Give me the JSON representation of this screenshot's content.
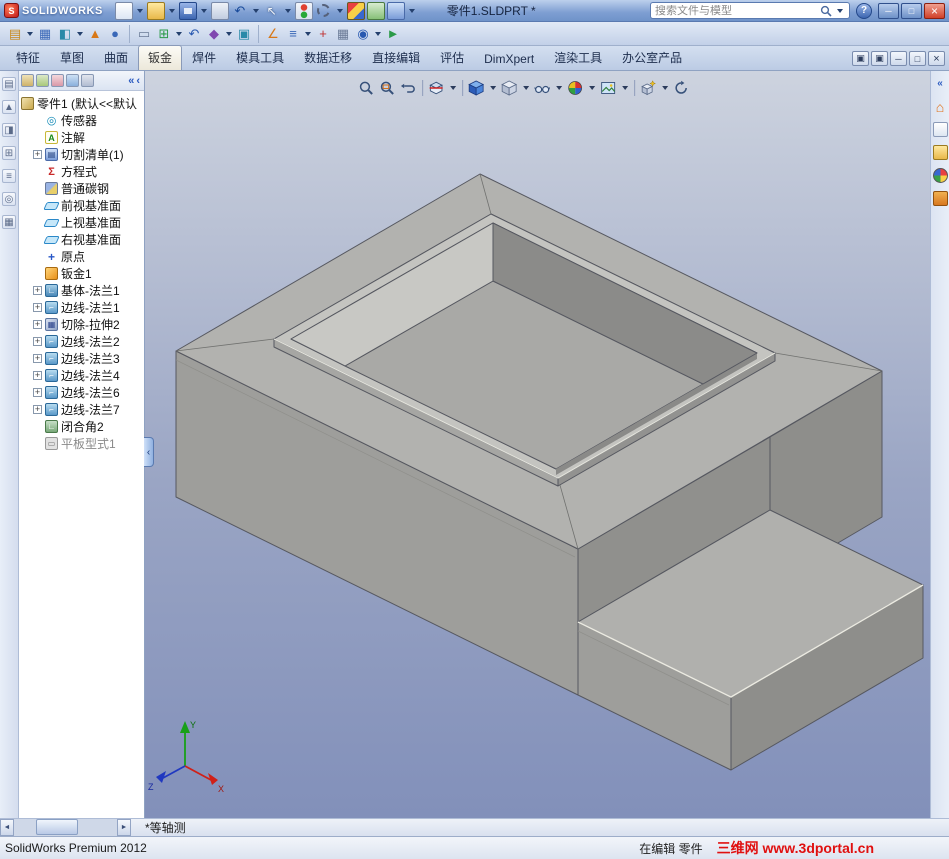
{
  "colors": {
    "titlebar_top": "#bdd0ec",
    "titlebar_bottom": "#6f93c9",
    "viewport_top": "#cdd3df",
    "viewport_bottom": "#8290ba",
    "accent_blue": "#2f66c0",
    "logo_red": "#c01818",
    "watermark_red": "#e01010",
    "part_top": "#b2b2af",
    "part_front": "#9e9e9b",
    "part_side": "#8e8e8b"
  },
  "title_bar": {
    "logo_text": "SOLIDWORKS",
    "doc_title": "零件1.SLDPRT *",
    "search_placeholder": "搜索文件与模型",
    "icons": [
      "new-document-icon",
      "open-icon",
      "save-icon",
      "print-icon",
      "undo-icon",
      "select-cursor-icon",
      "rebuild-icon",
      "options-icon",
      "color-swatch-icon",
      "table-icon",
      "grid-icon"
    ],
    "window_buttons": [
      "help-icon",
      "minimize-icon",
      "maximize-icon",
      "close-icon"
    ]
  },
  "toolbar": {
    "icons": [
      {
        "name": "toolbar-icon-1",
        "glyph": "▤",
        "color": "#c8881a",
        "caret": true
      },
      {
        "name": "toolbar-icon-2",
        "glyph": "▦",
        "color": "#3a68b8"
      },
      {
        "name": "toolbar-icon-3",
        "glyph": "◧",
        "color": "#2a8aa8",
        "caret": true
      },
      {
        "name": "toolbar-icon-4",
        "glyph": "▲",
        "color": "#d87818"
      },
      {
        "name": "toolbar-icon-5",
        "glyph": "●",
        "color": "#3a68b8"
      },
      {
        "sep": true
      },
      {
        "name": "toolbar-icon-6",
        "glyph": "▭",
        "color": "#6a7a96"
      },
      {
        "name": "toolbar-icon-7",
        "glyph": "⊞",
        "color": "#2a9a48",
        "caret": true
      },
      {
        "name": "toolbar-icon-8",
        "glyph": "↶",
        "color": "#2858b0"
      },
      {
        "name": "toolbar-icon-9",
        "glyph": "◆",
        "color": "#8048b0",
        "caret": true
      },
      {
        "name": "toolbar-icon-10",
        "glyph": "▣",
        "color": "#2a8aa8"
      },
      {
        "sep": true
      },
      {
        "name": "toolbar-icon-11",
        "glyph": "∠",
        "color": "#d87818"
      },
      {
        "name": "toolbar-icon-12",
        "glyph": "≡",
        "color": "#3a68b8",
        "caret": true
      },
      {
        "name": "toolbar-icon-13",
        "glyph": "+",
        "color": "#c03030"
      },
      {
        "name": "toolbar-icon-14",
        "glyph": "▦",
        "color": "#6a7a96"
      },
      {
        "name": "toolbar-icon-15",
        "glyph": "◉",
        "color": "#2858b0",
        "caret": true
      },
      {
        "name": "toolbar-icon-16",
        "glyph": "►",
        "color": "#2a9a48"
      }
    ]
  },
  "ribbon_tabs": {
    "items": [
      {
        "label": "特征"
      },
      {
        "label": "草图"
      },
      {
        "label": "曲面"
      },
      {
        "label": "钣金",
        "active": true
      },
      {
        "label": "焊件"
      },
      {
        "label": "模具工具"
      },
      {
        "label": "数据迁移"
      },
      {
        "label": "直接编辑"
      },
      {
        "label": "评估"
      },
      {
        "label": "DimXpert"
      },
      {
        "label": "渲染工具"
      },
      {
        "label": "办公室产品"
      }
    ],
    "doc_window_buttons": [
      "tile-icon",
      "cascade-icon",
      "minimize-icon",
      "restore-icon",
      "close-icon"
    ]
  },
  "feature_tree": {
    "header_icons": [
      "featuremanager-tab-icon",
      "propertymanager-tab-icon",
      "configurationmanager-tab-icon",
      "dimxpertmanager-tab-icon",
      "displaymanager-tab-icon"
    ],
    "collapse_left": "«",
    "collapse_right": "‹",
    "items": [
      {
        "label": "零件1 (默认<<默认",
        "icon": "part-icon",
        "root": true
      },
      {
        "label": "传感器",
        "icon": "sensors-icon"
      },
      {
        "label": "注解",
        "icon": "annotations-icon"
      },
      {
        "label": "切割清单(1)",
        "icon": "cutlist-icon",
        "plus": true
      },
      {
        "label": "方程式",
        "icon": "equations-icon"
      },
      {
        "label": "普通碳钢",
        "icon": "material-icon"
      },
      {
        "label": "前视基准面",
        "icon": "plane-icon"
      },
      {
        "label": "上视基准面",
        "icon": "plane-icon"
      },
      {
        "label": "右视基准面",
        "icon": "plane-icon"
      },
      {
        "label": "原点",
        "icon": "origin-icon"
      },
      {
        "label": "钣金1",
        "icon": "sheetmetal-icon"
      },
      {
        "label": "基体-法兰1",
        "icon": "base-flange-icon",
        "plus": true
      },
      {
        "label": "边线-法兰1",
        "icon": "edge-flange-icon",
        "plus": true
      },
      {
        "label": "切除-拉伸2",
        "icon": "cut-extrude-icon",
        "plus": true
      },
      {
        "label": "边线-法兰2",
        "icon": "edge-flange-icon",
        "plus": true
      },
      {
        "label": "边线-法兰3",
        "icon": "edge-flange-icon",
        "plus": true
      },
      {
        "label": "边线-法兰4",
        "icon": "edge-flange-icon",
        "plus": true
      },
      {
        "label": "边线-法兰6",
        "icon": "edge-flange-icon",
        "plus": true
      },
      {
        "label": "边线-法兰7",
        "icon": "edge-flange-icon",
        "plus": true
      },
      {
        "label": "闭合角2",
        "icon": "closed-corner-icon"
      },
      {
        "label": "平板型式1",
        "icon": "flat-pattern-icon",
        "suppressed": true
      }
    ]
  },
  "left_toolbar": {
    "icons": [
      {
        "name": "left-toolbar-icon-1",
        "glyph": "▤"
      },
      {
        "name": "left-toolbar-icon-2",
        "glyph": "▲"
      },
      {
        "name": "left-toolbar-icon-3",
        "glyph": "◨"
      },
      {
        "name": "left-toolbar-icon-4",
        "glyph": "⊞"
      },
      {
        "name": "left-toolbar-icon-5",
        "glyph": "≡"
      },
      {
        "name": "left-toolbar-icon-6",
        "glyph": "◎"
      },
      {
        "name": "left-toolbar-icon-7",
        "glyph": "▦"
      }
    ]
  },
  "viewport": {
    "headsup_icons": [
      "zoom-fit-icon",
      "zoom-area-icon",
      "previous-view-icon",
      "section-view-icon",
      "view-orientation-icon",
      "display-style-icon",
      "hide-show-icon",
      "edit-appearance-icon",
      "apply-scene-icon",
      "view-settings-icon",
      "rotate-view-icon"
    ],
    "view_label": "*等轴测",
    "triad": {
      "x": "X",
      "y": "Y",
      "z": "Z"
    }
  },
  "task_pane": {
    "icons": [
      "collapse-arrows-icon",
      "home-icon",
      "file-explorer-icon",
      "design-library-icon",
      "appearances-icon",
      "toolbox-icon"
    ]
  },
  "status_bar": {
    "left": "SolidWorks Premium 2012",
    "editing": "在编辑 零件",
    "watermark": "三维网 www.3dportal.cn"
  }
}
